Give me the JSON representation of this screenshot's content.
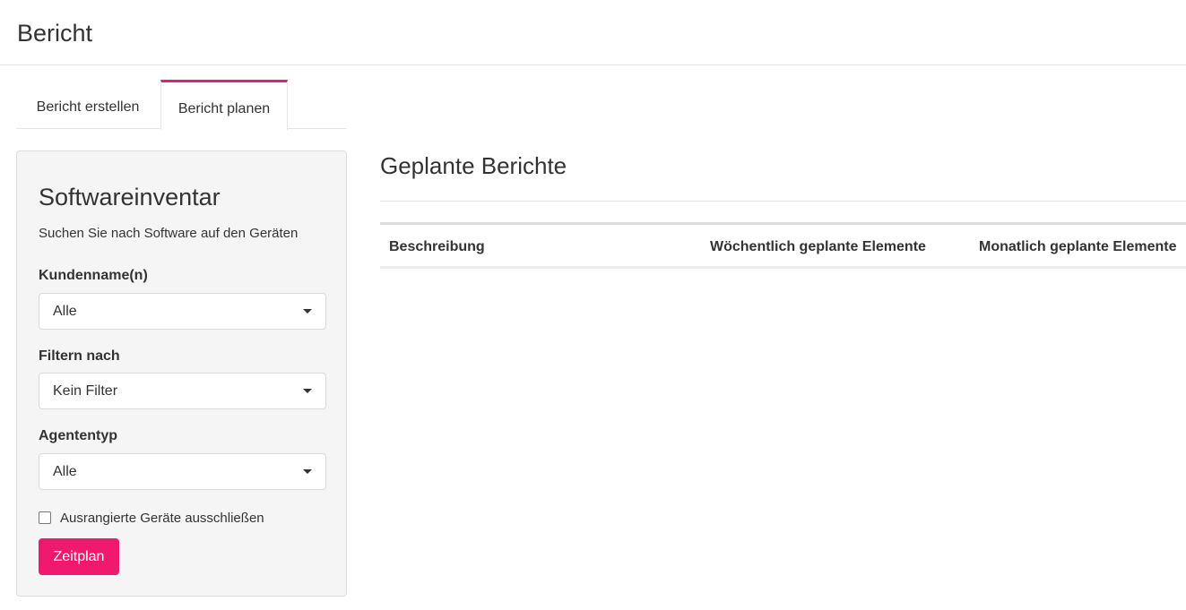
{
  "header": {
    "title": "Bericht"
  },
  "tabs": [
    {
      "label": "Bericht erstellen",
      "active": false
    },
    {
      "label": "Bericht planen",
      "active": true
    }
  ],
  "sidebar": {
    "title": "Softwareinventar",
    "subtitle": "Suchen Sie nach Software auf den Geräten",
    "customer": {
      "label": "Kundenname(n)",
      "value": "Alle"
    },
    "filter": {
      "label": "Filtern nach",
      "value": "Kein Filter"
    },
    "agent_type": {
      "label": "Agententyp",
      "value": "Alle"
    },
    "exclude_retired": {
      "label": "Ausrangierte Geräte ausschließen",
      "checked": false
    },
    "schedule_button": "Zeitplan"
  },
  "main": {
    "title": "Geplante Berichte",
    "table": {
      "columns": [
        "Beschreibung",
        "Wöchentlich geplante Elemente",
        "Monatlich geplante Elemente"
      ],
      "rows": []
    }
  },
  "colors": {
    "accent": "#e0226e",
    "button": "#f0196e"
  }
}
